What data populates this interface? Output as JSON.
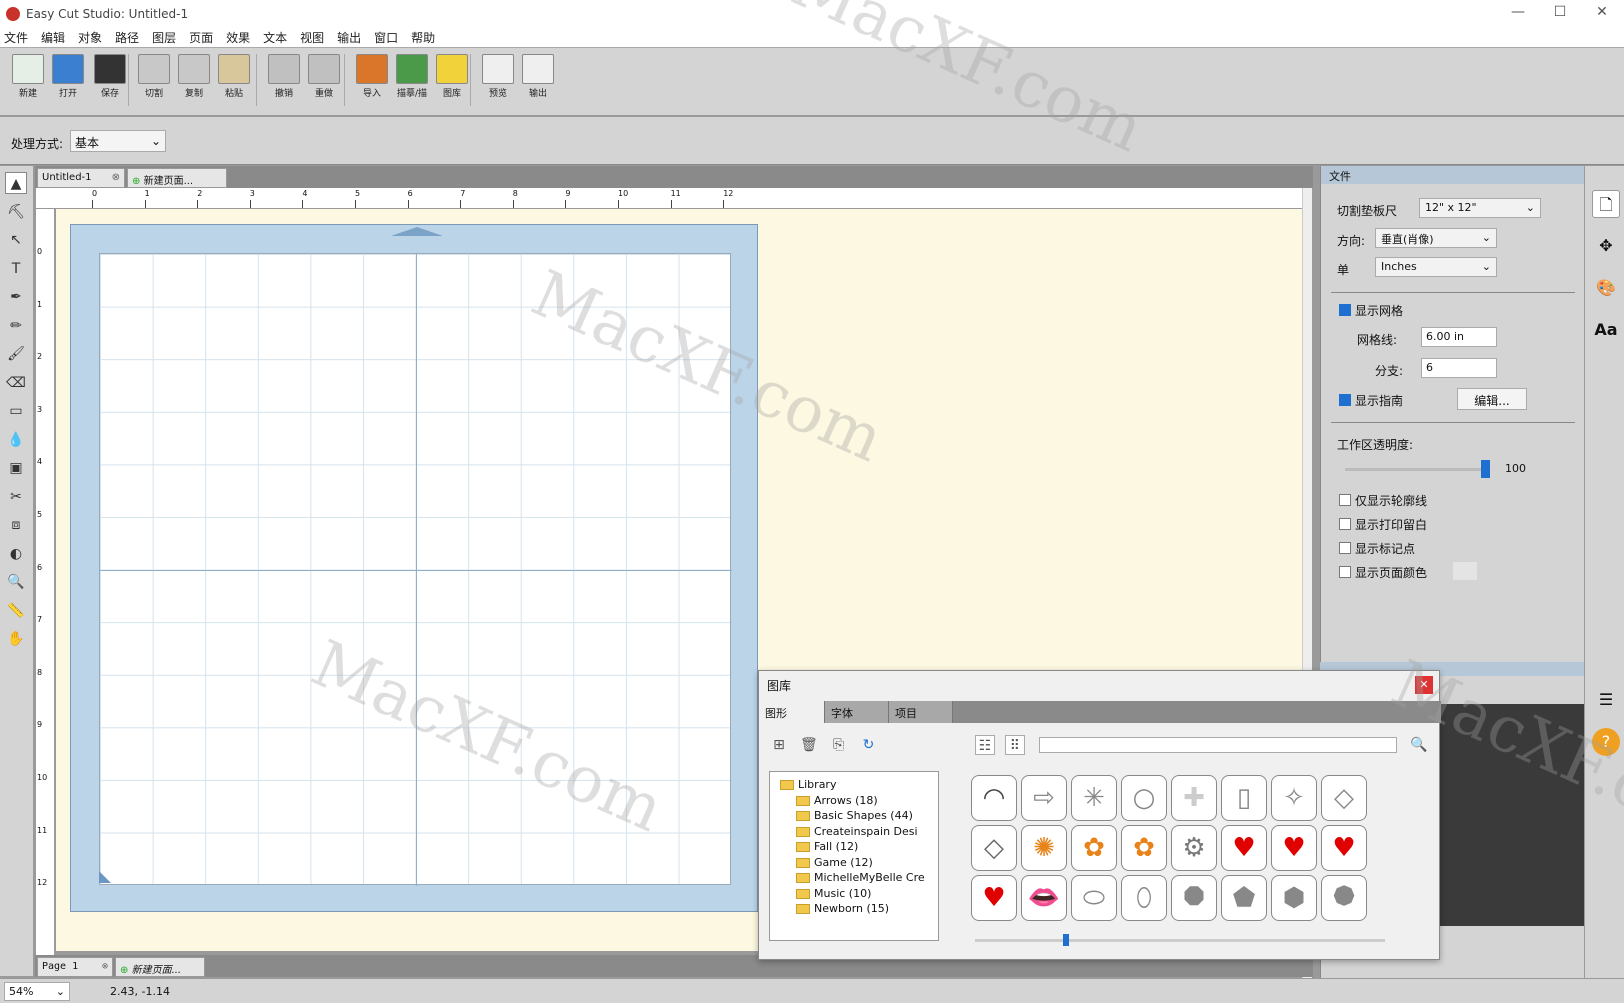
{
  "window": {
    "title": "Easy Cut Studio: Untitled-1",
    "minimize": "—",
    "maximize": "☐",
    "close": "✕"
  },
  "menu": [
    "文件",
    "编辑",
    "对象",
    "路径",
    "图层",
    "页面",
    "效果",
    "文本",
    "视图",
    "输出",
    "窗口",
    "帮助"
  ],
  "toolbar": [
    {
      "label": "新建",
      "icon": "new-document-icon",
      "color": "#e6efe6"
    },
    {
      "label": "打开",
      "icon": "open-folder-icon",
      "color": "#3a7fd0"
    },
    {
      "label": "保存",
      "icon": "save-disk-icon",
      "color": "#333333"
    },
    {
      "label": "切割",
      "icon": "cut-scissors-icon",
      "color": "#c8c8c8"
    },
    {
      "label": "复制",
      "icon": "copy-icon",
      "color": "#c8c8c8"
    },
    {
      "label": "粘贴",
      "icon": "paste-icon",
      "color": "#d8c79a"
    },
    {
      "label": "撤销",
      "icon": "undo-icon",
      "color": "#c0c0c0"
    },
    {
      "label": "重做",
      "icon": "redo-icon",
      "color": "#c0c0c0"
    },
    {
      "label": "导入",
      "icon": "import-svg-icon",
      "color": "#d9762a"
    },
    {
      "label": "描摹/描",
      "icon": "trace-image-icon",
      "color": "#4a9a4a"
    },
    {
      "label": "图库",
      "icon": "library-star-icon",
      "color": "#f2d23a"
    },
    {
      "label": "预览",
      "icon": "preview-magnifier-icon",
      "color": "#efefef"
    },
    {
      "label": "输出",
      "icon": "output-pen-icon",
      "color": "#efefef"
    }
  ],
  "mode": {
    "label": "处理方式:",
    "value": "基本"
  },
  "tools": [
    "▲",
    "⛏",
    "↖",
    "T",
    "✒",
    "✏",
    "🖌",
    "⌫",
    "▭",
    "💧",
    "▣",
    "✂",
    "⧈",
    "◐",
    "🔍",
    "📏",
    "✋"
  ],
  "tool_names": [
    "select-arrow-icon",
    "lasso-icon",
    "node-edit-icon",
    "text-icon",
    "pen-icon",
    "pencil-icon",
    "brush-icon",
    "eraser-icon",
    "rectangle-icon",
    "eyedropper-icon",
    "fill-icon",
    "knife-icon",
    "transform-icon",
    "contrast-icon",
    "zoom-icon",
    "ruler-icon",
    "hand-icon"
  ],
  "doc_tabs": {
    "current": "Untitled-1",
    "new": "新建页面..."
  },
  "ruler_h": [
    "0",
    "1",
    "2",
    "3",
    "4",
    "5",
    "6",
    "7",
    "8",
    "9",
    "10",
    "11",
    "12"
  ],
  "ruler_v": [
    "0",
    "1",
    "2",
    "3",
    "4",
    "5",
    "6",
    "7",
    "8",
    "9",
    "10",
    "11",
    "12"
  ],
  "bottom_tabs": {
    "page": "Page 1",
    "new": "新建页面..."
  },
  "status": {
    "zoom": "54%",
    "coords": "2.43, -1.14"
  },
  "panel": {
    "title": "文件",
    "mat_label": "切割垫板尺",
    "mat_value": "12\" x 12\"",
    "orient_label": "方向:",
    "orient_value": "垂直(肖像)",
    "unit_label": "单",
    "unit_value": "Inches",
    "show_grid": "显示网格",
    "gridline_label": "网格线:",
    "gridline_value": "6.00 in",
    "sub_label": "分支:",
    "sub_value": "6",
    "show_guides": "显示指南",
    "edit_btn": "编辑...",
    "opacity_label": "工作区透明度:",
    "opacity_value": "100",
    "opt1": "仅显示轮廓线",
    "opt2": "显示打印留白",
    "opt3": "显示标记点",
    "opt4": "显示页面颜色"
  },
  "library": {
    "title": "图库",
    "tabs": [
      "图形",
      "字体",
      "项目"
    ],
    "tree": [
      "Library",
      "Arrows (18)",
      "Basic Shapes (44)",
      "Createinspain Desi",
      "Fall (12)",
      "Game (12)",
      "MichelleMyBelle Cre",
      "Music (10)",
      "Newborn (15)"
    ],
    "shapes": [
      {
        "g": "◠",
        "c": "#444444"
      },
      {
        "g": "⇨",
        "c": "#888888"
      },
      {
        "g": "✳",
        "c": "#888888"
      },
      {
        "g": "○",
        "c": "#888888"
      },
      {
        "g": "✚",
        "c": "#cccccc"
      },
      {
        "g": "▯",
        "c": "#888888"
      },
      {
        "g": "✧",
        "c": "#888888"
      },
      {
        "g": "◇",
        "c": "#888888"
      },
      {
        "g": "◇",
        "c": "#666666"
      },
      {
        "g": "✺",
        "c": "#e8831a"
      },
      {
        "g": "✿",
        "c": "#e8831a"
      },
      {
        "g": "✿",
        "c": "#e8831a"
      },
      {
        "g": "⚙",
        "c": "#777777"
      },
      {
        "g": "♥",
        "c": "#e00000"
      },
      {
        "g": "♥",
        "c": "#e00000"
      },
      {
        "g": "♥",
        "c": "#e00000"
      },
      {
        "g": "♥",
        "c": "#e00000"
      },
      {
        "g": "👄",
        "c": "#d40000"
      },
      {
        "g": "⬭",
        "c": "#888888"
      },
      {
        "g": "⬯",
        "c": "#888888"
      },
      {
        "g": "⯃",
        "c": "#888888"
      },
      {
        "g": "⬟",
        "c": "#888888"
      },
      {
        "g": "⬢",
        "c": "#888888"
      },
      {
        "g": "⯄",
        "c": "#888888"
      }
    ]
  },
  "watermark": "MacXF.com"
}
